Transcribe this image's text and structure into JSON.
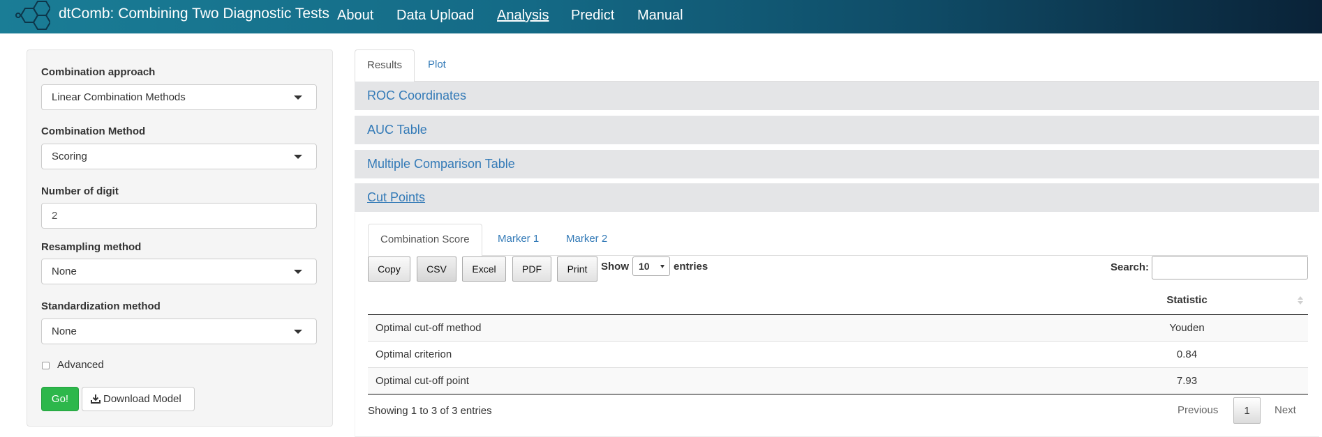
{
  "app": {
    "title": "dtComb: Combining Two Diagnostic Tests",
    "nav": [
      "About",
      "Data Upload",
      "Analysis",
      "Predict",
      "Manual"
    ],
    "active_nav": "Analysis"
  },
  "sidebar": {
    "combination_approach": {
      "label": "Combination approach",
      "value": "Linear Combination Methods"
    },
    "combination_method": {
      "label": "Combination Method",
      "value": "Scoring"
    },
    "number_of_digit": {
      "label": "Number of digit",
      "value": "2"
    },
    "resampling_method": {
      "label": "Resampling method",
      "value": "None"
    },
    "standardization_method": {
      "label": "Standardization method",
      "value": "None"
    },
    "advanced": {
      "label": "Advanced",
      "checked": false
    },
    "go_label": "Go!",
    "download_label": "Download Model"
  },
  "main": {
    "tabs": [
      "Results",
      "Plot"
    ],
    "active_tab": "Results",
    "accordion": [
      "ROC Coordinates",
      "AUC Table",
      "Multiple Comparison Table",
      "Cut Points"
    ],
    "open_section": "Cut Points",
    "subtabs": [
      "Combination Score",
      "Marker 1",
      "Marker 2"
    ],
    "active_subtab": "Combination Score",
    "export_buttons": [
      "Copy",
      "CSV",
      "Excel",
      "PDF",
      "Print"
    ],
    "show_label": "Show",
    "entries_value": "10",
    "entries_label": "entries",
    "search_label": "Search:",
    "search_value": "",
    "table": {
      "columns": [
        "",
        "Statistic"
      ],
      "rows": [
        [
          "Optimal cut-off method",
          "Youden"
        ],
        [
          "Optimal criterion",
          "0.84"
        ],
        [
          "Optimal cut-off point",
          "7.93"
        ]
      ]
    },
    "info": "Showing 1 to 3 of 3 entries",
    "pagination": {
      "previous": "Previous",
      "current": "1",
      "next": "Next"
    }
  },
  "colors": {
    "navbar_start": "#1a7d96",
    "navbar_end": "#0a2237",
    "link": "#337ab7",
    "go_button": "#2db74b",
    "accordion_bg": "#e4e5e7"
  }
}
